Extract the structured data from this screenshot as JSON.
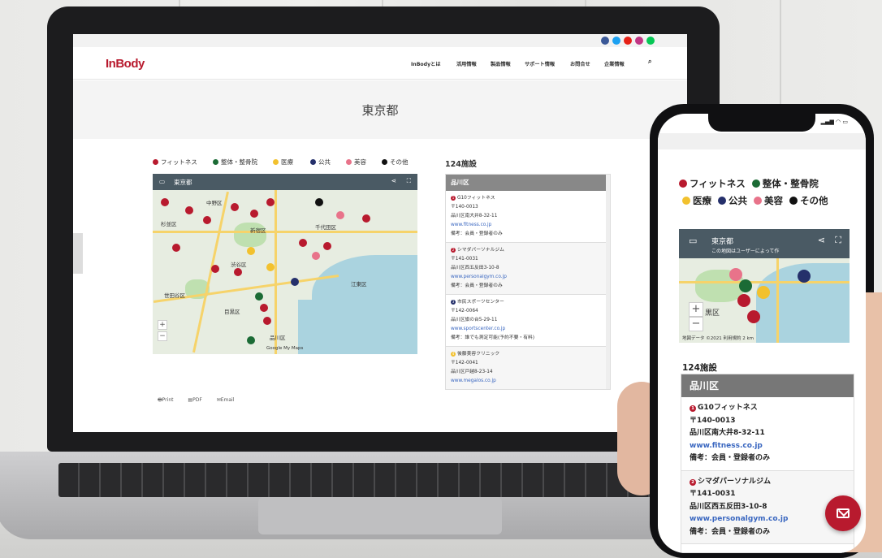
{
  "site": {
    "logo": "InBody",
    "nav": [
      "InBodyとは",
      "活用情報",
      "製品情報",
      "サポート情報",
      "お問合せ",
      "企業情報"
    ],
    "search_icon": "search-icon",
    "social_icons": [
      "facebook-icon",
      "twitter-icon",
      "youtube-icon",
      "instagram-icon",
      "line-icon"
    ],
    "social_colors": [
      "#3b5998",
      "#1da1f2",
      "#e62117",
      "#c13584",
      "#06c755"
    ],
    "page_title": "東京都"
  },
  "legend": [
    {
      "label": "フィットネス",
      "color": "#b81a2e"
    },
    {
      "label": "整体・整骨院",
      "color": "#1b6b35"
    },
    {
      "label": "医療",
      "color": "#f2c12e"
    },
    {
      "label": "公共",
      "color": "#25306b"
    },
    {
      "label": "美容",
      "color": "#e8738a"
    },
    {
      "label": "その他",
      "color": "#111111"
    }
  ],
  "map": {
    "title": "東京都",
    "phone_notice": "この地図はユーザーによって作",
    "labels": [
      "中野区",
      "杉並区",
      "新宿区",
      "千代田区",
      "渋谷区",
      "江東区",
      "世田谷区",
      "目黒区",
      "品川区"
    ],
    "phone_labels": [
      "黒区",
      "品川区"
    ],
    "zoom_in": "+",
    "zoom_out": "−",
    "attribution": "Google My Maps",
    "phone_attribution": "地図データ ©2021   利用規約   2 km"
  },
  "facilities": {
    "count_label": "124施設",
    "group": "品川区",
    "entries": [
      {
        "num": "1",
        "name": "G10フィットネス",
        "postal": "〒140-0013",
        "address": "品川区南大井8-32-11",
        "url": "www.fitness.co.jp",
        "note": "備考：会員・登録者のみ"
      },
      {
        "num": "2",
        "name": "シマダパーソナルジム",
        "postal": "〒141-0031",
        "address": "品川区西五反田3-10-8",
        "url": "www.personalgym.co.jp",
        "note": "備考：会員・登録者のみ"
      },
      {
        "num": "3",
        "name": "市民スポーツセンター",
        "postal": "〒142-0064",
        "address": "品川区旗の台5-29-11",
        "url": "www.sportscenter.co.jp",
        "note": "備考：誰でも測定可能(予約不要・有料)"
      },
      {
        "num": "4",
        "name": "後藤美容クリニック",
        "postal": "〒142-0041",
        "address": "品川区戸越8-23-14",
        "url": "www.megalos.co.jp",
        "note": ""
      }
    ]
  },
  "share": {
    "print": "Print",
    "pdf": "PDF",
    "email": "Email"
  },
  "phone": {
    "time": "",
    "mail_icon": "mail-icon"
  }
}
